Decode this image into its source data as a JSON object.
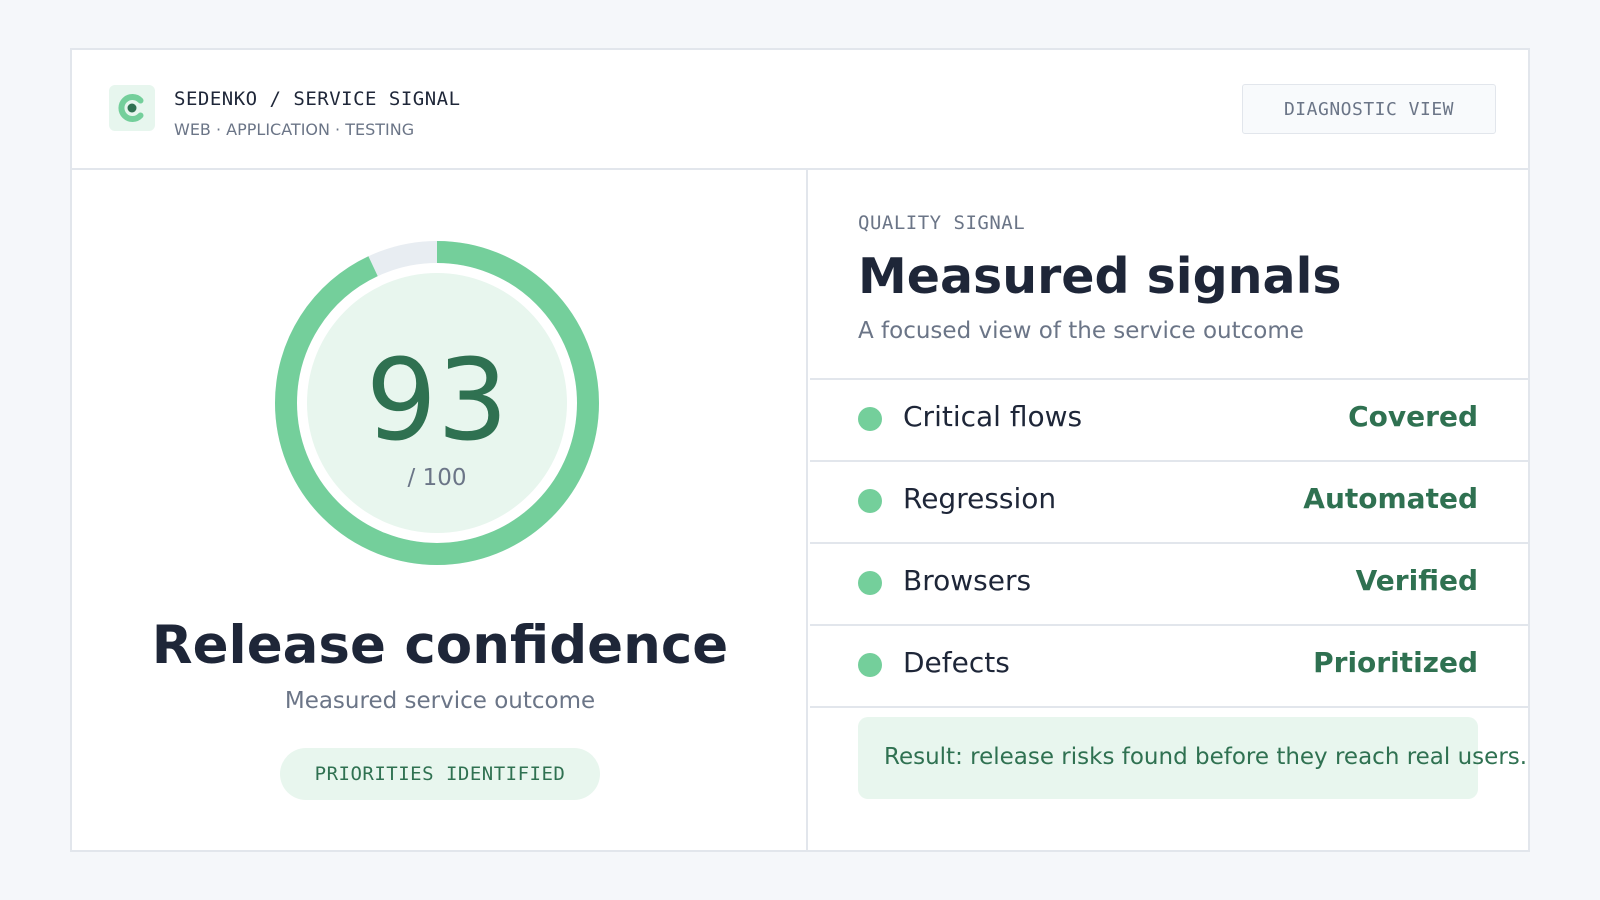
{
  "header": {
    "brand": "SEDENKO / SERVICE SIGNAL",
    "tagline": "WEB · APPLICATION · TESTING",
    "diagnostic_button": "DIAGNOSTIC VIEW"
  },
  "score": {
    "value": "93",
    "max_label": "/ 100",
    "fraction": 0.93,
    "title": "Release confidence",
    "subtitle": "Measured service outcome",
    "badge": "PRIORITIES IDENTIFIED"
  },
  "signals": {
    "eyebrow": "QUALITY SIGNAL",
    "title": "Measured signals",
    "subtitle": "A focused view of the service outcome",
    "rows": [
      {
        "label": "Critical flows",
        "value": "Covered"
      },
      {
        "label": "Regression",
        "value": "Automated"
      },
      {
        "label": "Browsers",
        "value": "Verified"
      },
      {
        "label": "Defects",
        "value": "Prioritized"
      }
    ],
    "result": "Result: release risks found before they reach real users."
  },
  "colors": {
    "accent": "#74cf9b",
    "accent_dark": "#2f7151",
    "accent_light": "#e8f6ee",
    "track": "#e8edf2"
  },
  "icons": {
    "logo": "c-logo-icon",
    "status_dot": "dot-icon"
  }
}
